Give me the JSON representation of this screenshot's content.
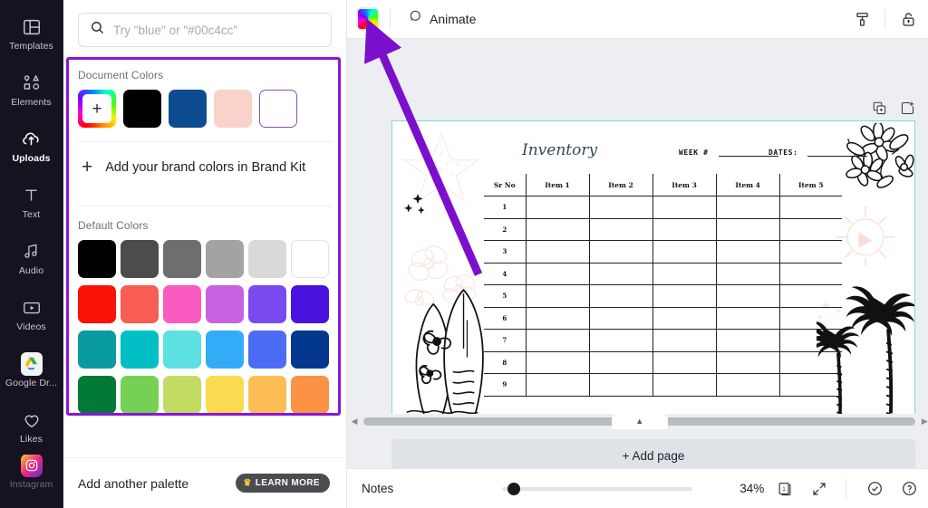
{
  "rail": {
    "items": [
      {
        "label": "Templates",
        "icon": "templates-icon",
        "active": false
      },
      {
        "label": "Elements",
        "icon": "elements-icon",
        "active": false
      },
      {
        "label": "Uploads",
        "icon": "uploads-icon",
        "active": true
      },
      {
        "label": "Text",
        "icon": "text-icon",
        "active": false
      },
      {
        "label": "Audio",
        "icon": "audio-icon",
        "active": false
      },
      {
        "label": "Videos",
        "icon": "videos-icon",
        "active": false
      },
      {
        "label": "Google Dr...",
        "icon": "google-drive-icon",
        "active": false
      },
      {
        "label": "Likes",
        "icon": "heart-icon",
        "active": false
      },
      {
        "label": "Instagram",
        "icon": "instagram-icon",
        "active": false
      }
    ]
  },
  "search": {
    "placeholder": "Try \"blue\" or \"#00c4cc\"",
    "value": "",
    "icon": "search-icon"
  },
  "panel": {
    "document_colors_title": "Document Colors",
    "document_colors": [
      {
        "name": "custom-color-picker",
        "color": "rainbow",
        "label": "+"
      },
      {
        "name": "doc-color-black",
        "color": "#000000"
      },
      {
        "name": "doc-color-blue",
        "color": "#0d4d8f"
      },
      {
        "name": "doc-color-pink",
        "color": "#f9d2c9"
      },
      {
        "name": "doc-color-white",
        "color": "#ffffff",
        "selected": true
      }
    ],
    "brandkit_label": "Add your brand colors in Brand Kit",
    "default_colors_title": "Default Colors",
    "default_colors": [
      "#000000",
      "#4c4c4c",
      "#6e6e6e",
      "#a3a3a3",
      "#d9d9d9",
      "#ffffff",
      "#fa1209",
      "#f85c52",
      "#fa5bc0",
      "#c762e3",
      "#7a49f0",
      "#4911dd",
      "#0a9ba1",
      "#02bfc6",
      "#5de0e0",
      "#32acf7",
      "#4d6cf5",
      "#04388f",
      "#007a36",
      "#76d053",
      "#c2db62",
      "#fada50",
      "#fcbd54",
      "#fb9244"
    ],
    "footer": {
      "add_palette_label": "Add another palette",
      "learn_more_label": "LEARN MORE",
      "crown_icon": "crown-icon"
    },
    "highlight_color": "#8c15d6"
  },
  "toolbar": {
    "color_button": "color-swatch-button",
    "animate_label": "Animate",
    "animate_icon": "animate-icon",
    "position_icon": "position-icon",
    "lock_icon": "lock-icon"
  },
  "canvas": {
    "duplicate_icon": "duplicate-page-icon",
    "add_note_icon": "add-note-icon",
    "add_page_label": "+ Add page",
    "page_border_color": "#7fd8e0"
  },
  "document": {
    "title": "Inventory",
    "week_label": "WEEK #",
    "dates_label": "DATES:",
    "columns": [
      "Sr No",
      "Item 1",
      "Item 2",
      "Item 3",
      "Item 4",
      "Item 5"
    ],
    "rows": [
      "1",
      "2",
      "3",
      "4",
      "5",
      "6",
      "7",
      "8",
      "9"
    ],
    "artwork": [
      "starfish",
      "sparkles",
      "hibiscus-flowers",
      "surfboards",
      "daisy-flowers",
      "sun",
      "palm-trees"
    ]
  },
  "statusbar": {
    "notes_label": "Notes",
    "zoom_level": "34%",
    "page_number": "1",
    "page_count_icon": "page-count-icon",
    "fullscreen_icon": "expand-icon",
    "check_icon": "check-circle-icon",
    "help_icon": "help-circle-icon"
  },
  "annotation": {
    "arrow_color": "#7b0fcc"
  }
}
